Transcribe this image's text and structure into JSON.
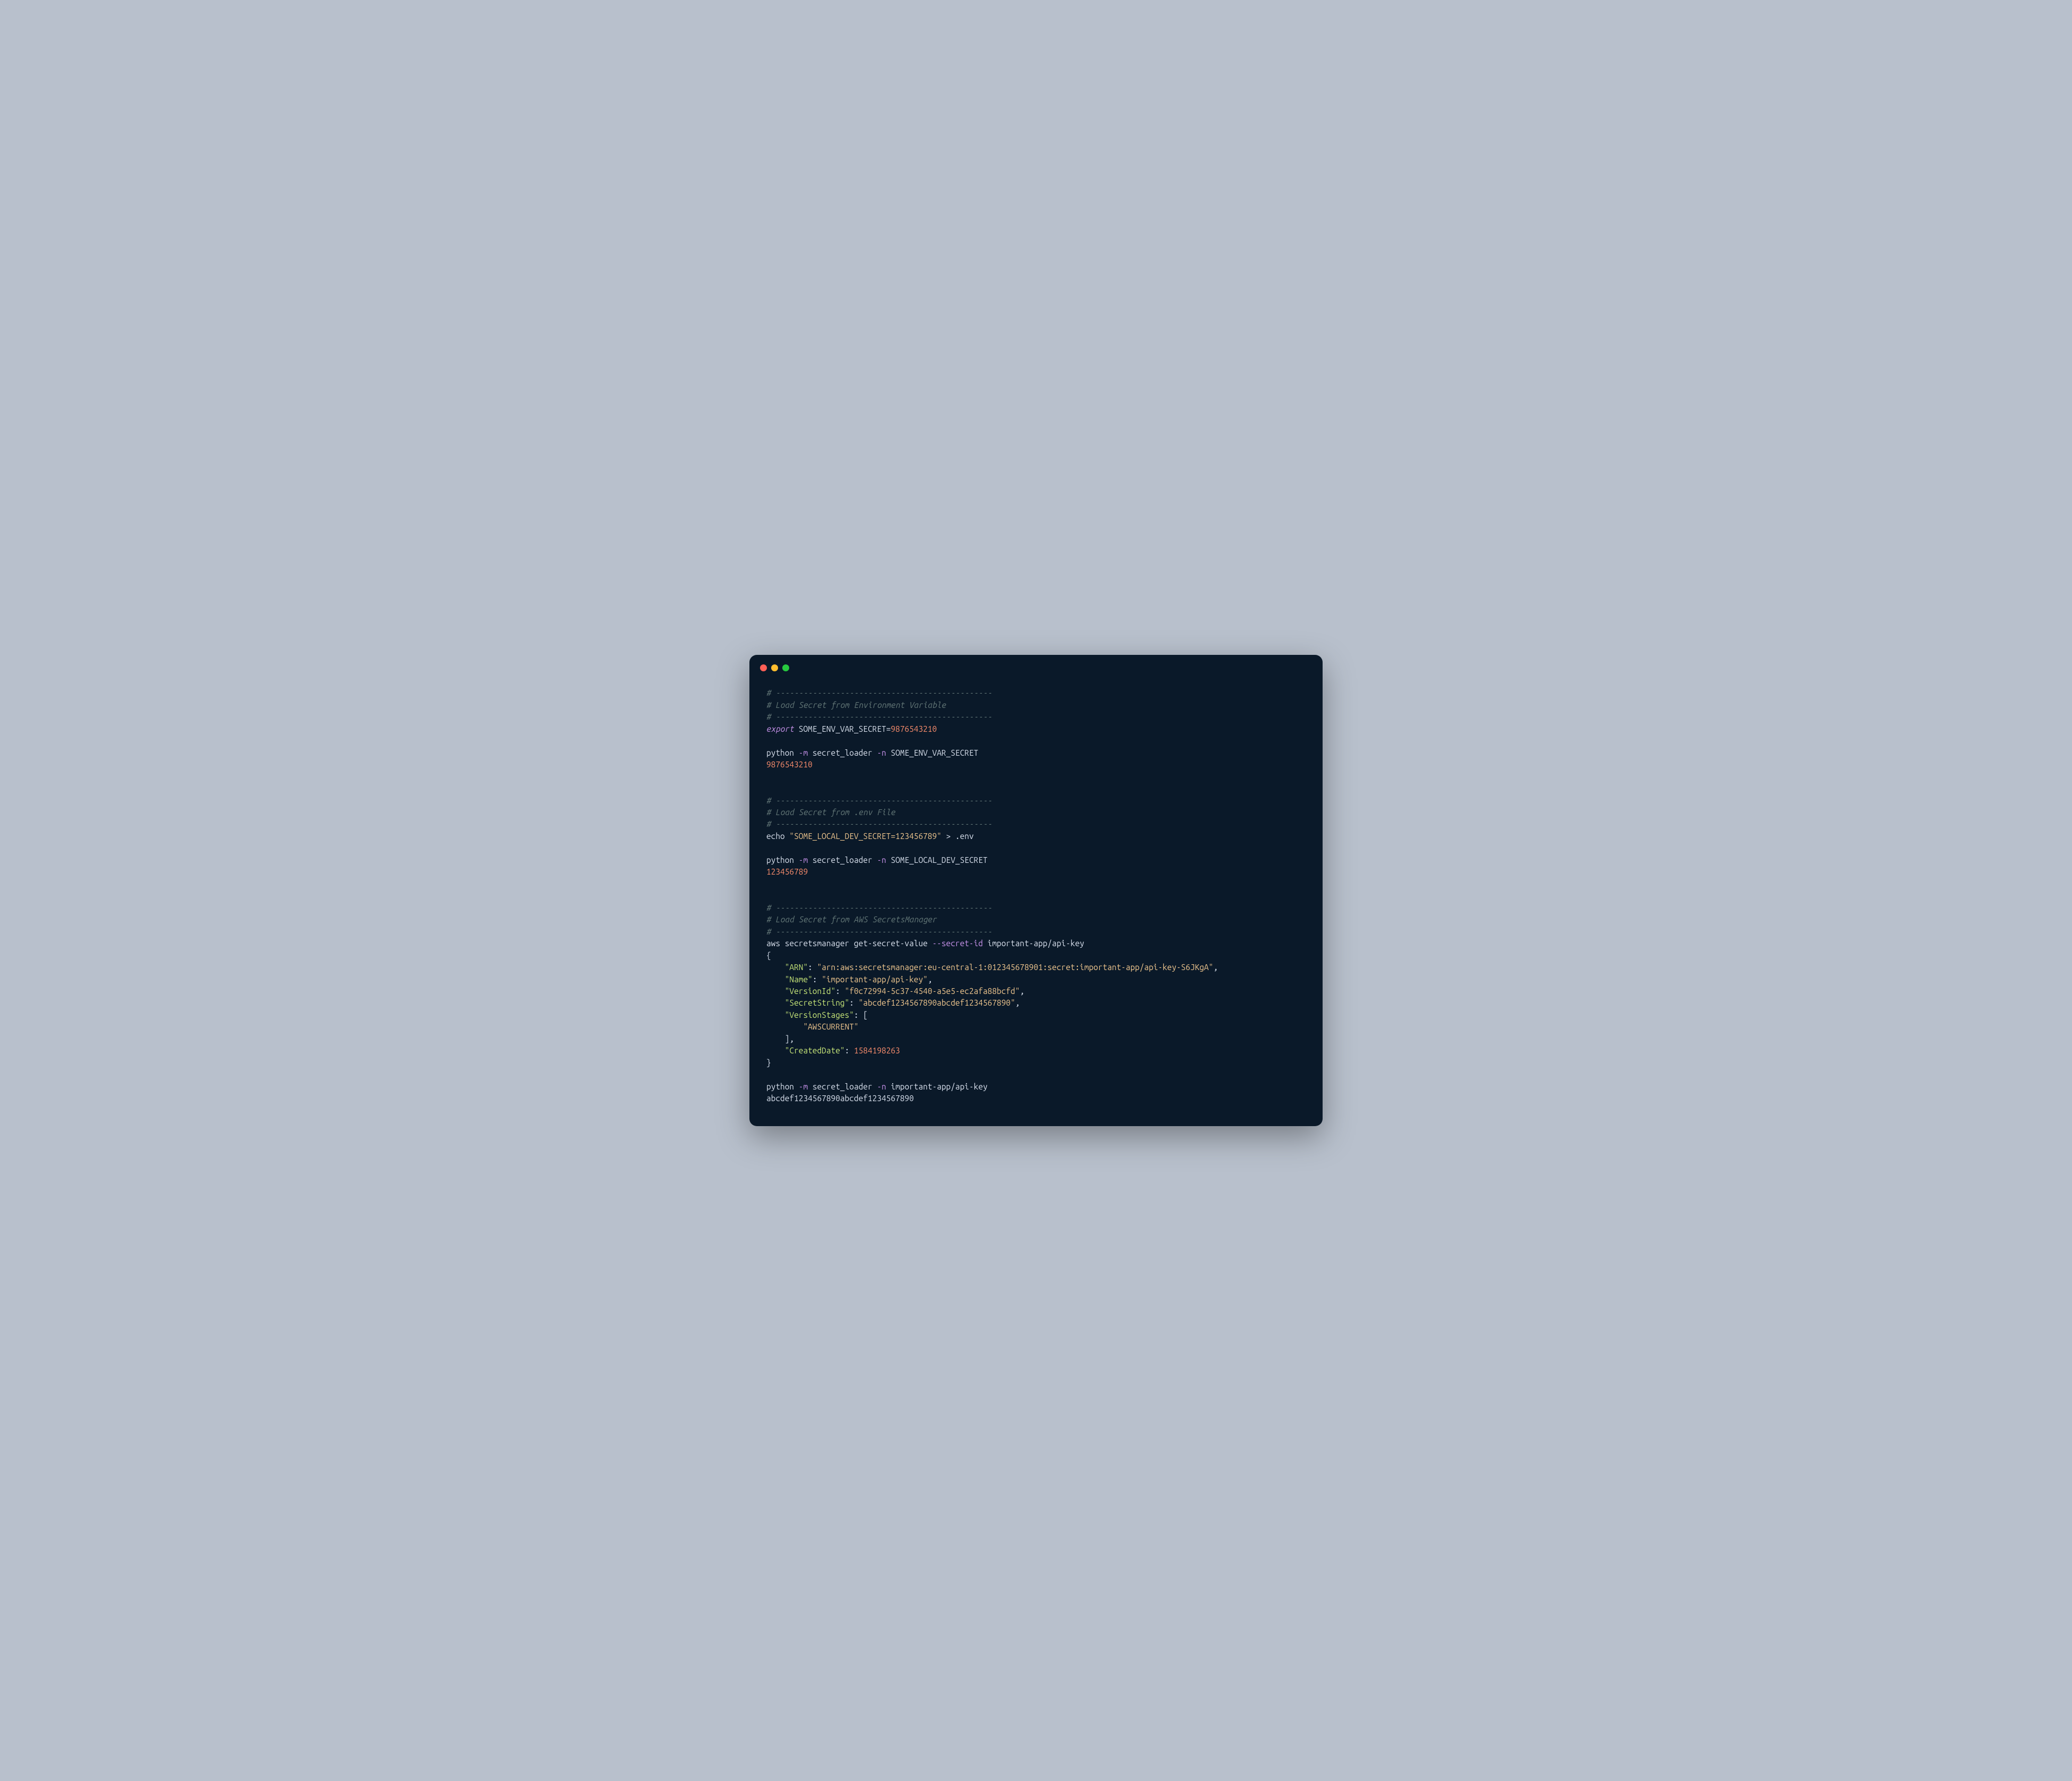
{
  "colors": {
    "bg_page": "#b8c0cc",
    "bg_terminal": "#0a1929",
    "comment": "#637777",
    "keyword": "#c792ea",
    "string": "#ecc48d",
    "number": "#f78c6c",
    "plain": "#d6deeb",
    "json_key": "#c5e478",
    "tl_close": "#ff5f56",
    "tl_min": "#ffbd2e",
    "tl_max": "#27c93f"
  },
  "section1": {
    "rule1": "# -----------------------------------------------",
    "title": "# Load Secret from Environment Variable",
    "rule2": "# -----------------------------------------------",
    "export_kw": "export",
    "export_rest": " SOME_ENV_VAR_SECRET=",
    "export_val": "9876543210",
    "cmd_python": "python ",
    "cmd_m": "-m",
    "cmd_module": " secret_loader ",
    "cmd_n": "-n",
    "cmd_name": " SOME_ENV_VAR_SECRET",
    "output": "9876543210"
  },
  "section2": {
    "rule1": "# -----------------------------------------------",
    "title": "# Load Secret from .env File",
    "rule2": "# -----------------------------------------------",
    "echo_cmd": "echo ",
    "echo_str": "\"SOME_LOCAL_DEV_SECRET=123456789\"",
    "echo_redir": " > .env",
    "cmd_python": "python ",
    "cmd_m": "-m",
    "cmd_module": " secret_loader ",
    "cmd_n": "-n",
    "cmd_name": " SOME_LOCAL_DEV_SECRET",
    "output": "123456789"
  },
  "section3": {
    "rule1": "# -----------------------------------------------",
    "title": "# Load Secret from AWS SecretsManager",
    "rule2": "# -----------------------------------------------",
    "aws_cmd": "aws secretsmanager get-secret-value ",
    "aws_flag": "--secret-id",
    "aws_arg": " important-app/api-key",
    "brace_open": "{",
    "arn_k": "    \"ARN\"",
    "colon": ": ",
    "arn_v": "\"arn:aws:secretsmanager:eu-central-1:012345678901:secret:important-app/api-key-S6JKgA\"",
    "comma": ",",
    "name_k": "    \"Name\"",
    "name_v": "\"important-app/api-key\"",
    "vid_k": "    \"VersionId\"",
    "vid_v": "\"f0c72994-5c37-4540-a5e5-ec2afa88bcfd\"",
    "ss_k": "    \"SecretString\"",
    "ss_v": "\"abcdef1234567890abcdef1234567890\"",
    "vs_k": "    \"VersionStages\"",
    "vs_open": ": [",
    "vs_item": "        \"AWSCURRENT\"",
    "vs_close": "    ],",
    "cd_k": "    \"CreatedDate\"",
    "cd_v": "1584198263",
    "brace_close": "}",
    "cmd_python": "python ",
    "cmd_m": "-m",
    "cmd_module": " secret_loader ",
    "cmd_n": "-n",
    "cmd_name": " important-app/api-key",
    "output": "abcdef1234567890abcdef1234567890"
  }
}
